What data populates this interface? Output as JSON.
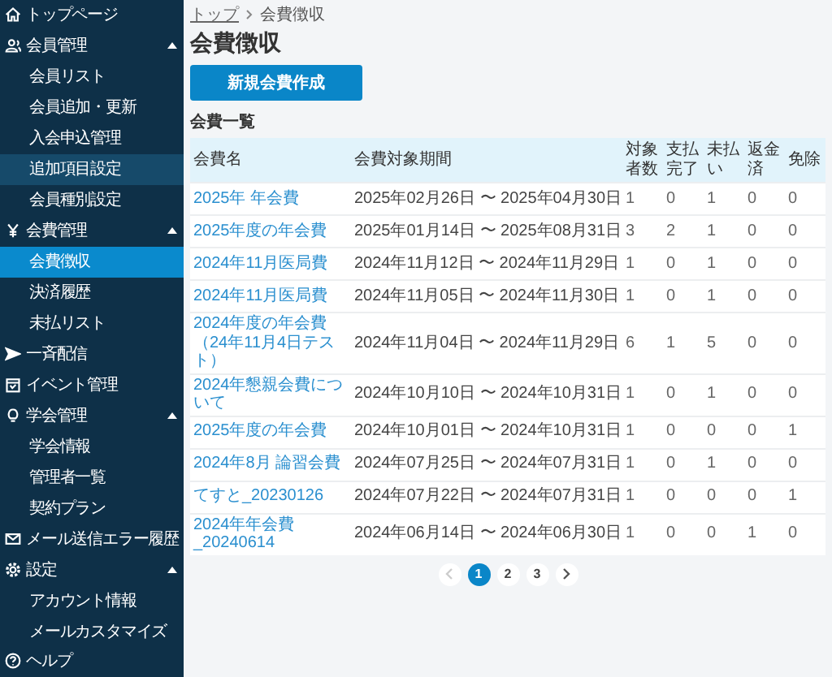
{
  "sidebar": {
    "items": [
      {
        "label": "トップページ",
        "selected": false,
        "hovered": false
      },
      {
        "label": "会員管理",
        "selected": false,
        "hovered": false,
        "expanded": true,
        "children": [
          {
            "label": "会員リスト",
            "selected": false,
            "hovered": false
          },
          {
            "label": "会員追加・更新",
            "selected": false,
            "hovered": false
          },
          {
            "label": "入会申込管理",
            "selected": false,
            "hovered": false
          },
          {
            "label": "追加項目設定",
            "selected": false,
            "hovered": true
          },
          {
            "label": "会員種別設定",
            "selected": false,
            "hovered": false
          }
        ]
      },
      {
        "label": "会費管理",
        "selected": false,
        "hovered": false,
        "expanded": true,
        "children": [
          {
            "label": "会費徴収",
            "selected": true,
            "hovered": false
          },
          {
            "label": "決済履歴",
            "selected": false,
            "hovered": false
          },
          {
            "label": "未払リスト",
            "selected": false,
            "hovered": false
          }
        ]
      },
      {
        "label": "一斉配信",
        "selected": false,
        "hovered": false
      },
      {
        "label": "イベント管理",
        "selected": false,
        "hovered": false
      },
      {
        "label": "学会管理",
        "selected": false,
        "hovered": false,
        "expanded": true,
        "children": [
          {
            "label": "学会情報",
            "selected": false,
            "hovered": false
          },
          {
            "label": "管理者一覧",
            "selected": false,
            "hovered": false
          },
          {
            "label": "契約プラン",
            "selected": false,
            "hovered": false
          }
        ]
      },
      {
        "label": "メール送信エラー履歴",
        "selected": false,
        "hovered": false
      },
      {
        "label": "設定",
        "selected": false,
        "hovered": false,
        "expanded": true,
        "children": [
          {
            "label": "アカウント情報",
            "selected": false,
            "hovered": false
          },
          {
            "label": "メールカスタマイズ",
            "selected": false,
            "hovered": false
          }
        ]
      },
      {
        "label": "ヘルプ",
        "selected": false,
        "hovered": false
      }
    ]
  },
  "breadcrumb": [
    "トップ",
    "会費徴収"
  ],
  "page_title": "会費徴収",
  "create_button": "新規会費作成",
  "section_title": "会費一覧",
  "table": {
    "columns": [
      "会費名",
      "会費対象期間",
      "対象者数",
      "支払完了",
      "未払い",
      "返金済",
      "免除"
    ],
    "rows": [
      {
        "name": "2025年 年会費",
        "period": "2025年02月26日 〜 2025年04月30日",
        "counts": [
          "1",
          "0",
          "1",
          "0",
          "0"
        ]
      },
      {
        "name": "2025年度の年会費",
        "period": "2025年01月14日 〜 2025年08月31日",
        "counts": [
          "3",
          "2",
          "1",
          "0",
          "0"
        ]
      },
      {
        "name": "2024年11月医局費",
        "period": "2024年11月12日 〜 2024年11月29日",
        "counts": [
          "1",
          "0",
          "1",
          "0",
          "0"
        ]
      },
      {
        "name": "2024年11月医局費",
        "period": "2024年11月05日 〜 2024年11月30日",
        "counts": [
          "1",
          "0",
          "1",
          "0",
          "0"
        ]
      },
      {
        "name": "2024年度の年会費（24年11月4日テスト）",
        "period": "2024年11月04日 〜 2024年11月29日",
        "counts": [
          "6",
          "1",
          "5",
          "0",
          "0"
        ]
      },
      {
        "name": "2024年懇親会費について",
        "period": "2024年10月10日 〜 2024年10月31日",
        "counts": [
          "1",
          "0",
          "1",
          "0",
          "0"
        ]
      },
      {
        "name": "2025年度の年会費",
        "period": "2024年10月01日 〜 2024年10月31日",
        "counts": [
          "1",
          "0",
          "0",
          "0",
          "1"
        ]
      },
      {
        "name": "2024年8月 論習会費",
        "period": "2024年07月25日 〜 2024年07月31日",
        "counts": [
          "1",
          "0",
          "1",
          "0",
          "0"
        ]
      },
      {
        "name": "てすと_20230126",
        "period": "2024年07月22日 〜 2024年07月31日",
        "counts": [
          "1",
          "0",
          "0",
          "0",
          "1"
        ]
      },
      {
        "name": "2024年年会費_20240614",
        "period": "2024年06月14日 〜 2024年06月30日",
        "counts": [
          "1",
          "0",
          "0",
          "1",
          "0"
        ]
      }
    ]
  },
  "pagination": {
    "prev": {
      "disabled": true
    },
    "next": {
      "disabled": false
    },
    "pages": [
      {
        "label": "1",
        "selected": true
      },
      {
        "label": "2",
        "selected": false
      },
      {
        "label": "3",
        "selected": false
      }
    ]
  }
}
